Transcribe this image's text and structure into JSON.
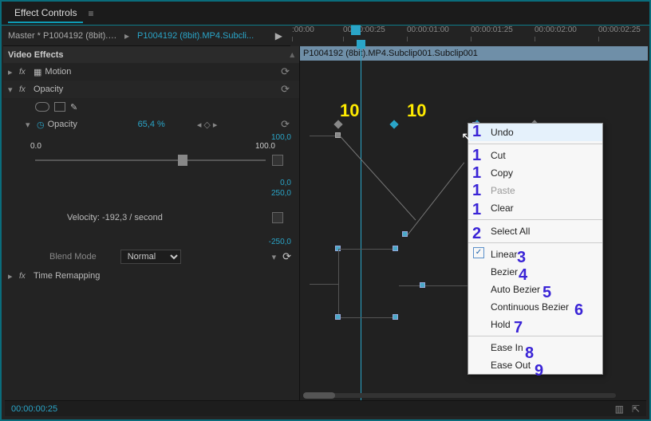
{
  "panel_title": "Effect Controls",
  "sub": {
    "master": "Master * P1004192 (8bit).MP...",
    "asset": "P1004192 (8bit).MP4.Subcli..."
  },
  "ruler": [
    ":00:00",
    "00:00:00:25",
    "00:00:01:00",
    "00:00:01:25",
    "00:00:02:00",
    "00:00:02:25"
  ],
  "sections": {
    "video_effects": "Video Effects",
    "motion": "Motion",
    "opacity": "Opacity",
    "opacity_prop": "Opacity",
    "blend_mode_label": "Blend Mode",
    "blend_mode_value": "Normal",
    "time_remap": "Time Remapping"
  },
  "opacity": {
    "value": "65,4 %",
    "graph_top": "100,0",
    "graph_bottom": "0,0",
    "slider_min": "0.0",
    "slider_max": "100.0",
    "vel_top": "250,0",
    "vel_bottom": "-250,0",
    "velocity_text": "Velocity: -192,3 / second"
  },
  "clip_name": "P1004192 (8bit).MP4.Subclip001.Subclip001",
  "context_menu": {
    "undo": "Undo",
    "cut": "Cut",
    "copy": "Copy",
    "paste": "Paste",
    "clear": "Clear",
    "select_all": "Select All",
    "linear": "Linear",
    "bezier": "Bezier",
    "auto_bezier": "Auto Bezier",
    "cont_bezier": "Continuous Bezier",
    "hold": "Hold",
    "ease_in": "Ease In",
    "ease_out": "Ease Out"
  },
  "footer_tc": "00:00:00:25",
  "annotations": {
    "ten_a": "10",
    "ten_b": "10",
    "n1": "1",
    "n2": "2",
    "n3": "3",
    "n4": "4",
    "n5": "5",
    "n6": "6",
    "n7": "7",
    "n8": "8",
    "n9": "9"
  }
}
